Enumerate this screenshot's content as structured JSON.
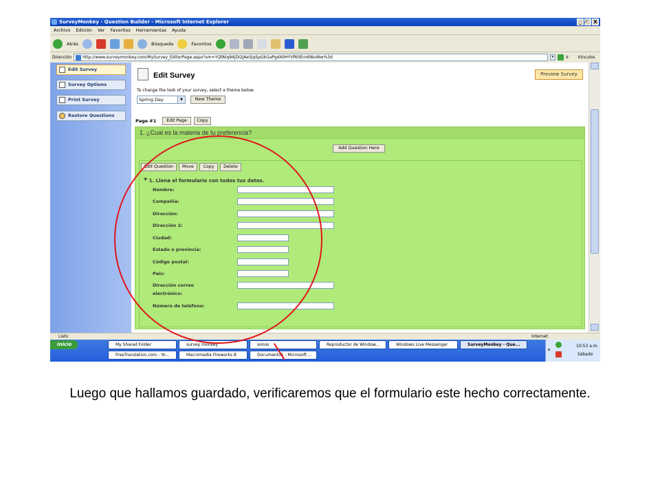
{
  "window": {
    "title": "SurveyMonkey - Question Builder - Microsoft Internet Explorer",
    "buttons": [
      "_",
      "̸",
      "X"
    ]
  },
  "menu": [
    "Archivo",
    "Edición",
    "Ver",
    "Favoritos",
    "Herramientas",
    "Ayuda"
  ],
  "toolbar": {
    "back": "Atrás",
    "search": "Búsqueda",
    "favorites": "Favoritos"
  },
  "address": {
    "label": "Dirección",
    "url": "http://www.surveymonkey.com/MySurvey_EditorPage.aspx?sm=YQfAtq94jDI2JAeSjqSpGkGaPgd40HYVf60Ern6WuWw%3d",
    "go": "Ir",
    "links": "Vínculos"
  },
  "sidebar": {
    "items": [
      {
        "label": "Edit Survey"
      },
      {
        "label": "Survey Options"
      },
      {
        "label": "Print Survey"
      },
      {
        "label": "Restore Questions"
      }
    ]
  },
  "main": {
    "title": "Edit Survey",
    "preview_button": "Preview Survey",
    "hint": "To change the look of your survey, select a theme below.",
    "theme": "Spring Day",
    "new_theme_button": "New Theme",
    "page_label": "Page #1",
    "edit_page_button": "Edit Page",
    "copy_page_button": "Copy",
    "question_title": "1. ¿Cual es la materia de tu preferencia?",
    "add_question_button": "Add Question Here",
    "q_edit_button": "Edit Question",
    "q_move_button": "Move",
    "q_copy_button": "Copy",
    "q_delete_button": "Delete",
    "required_mark": "*",
    "form_title": "1. Llena el formulario con todos tus datos.",
    "fields": [
      {
        "label": "Nombre:"
      },
      {
        "label": "Compañia:"
      },
      {
        "label": "Dirección:"
      },
      {
        "label": "Dirección 2:"
      },
      {
        "label": "Ciudad:"
      },
      {
        "label": "Estado o provincia:"
      },
      {
        "label": "Código postal:"
      },
      {
        "label": "País:"
      },
      {
        "label": "Dirección correo"
      },
      {
        "label": "electrónico:"
      },
      {
        "label": "Número de teléfono:"
      }
    ]
  },
  "status": {
    "left": "Listo",
    "zone": "Internet"
  },
  "taskbar": {
    "start": "Inicio",
    "tasks": [
      "My Shared Folder",
      "survey monkey",
      "sonos",
      "Reproductor de Window...",
      "Windows Live Messenger",
      "SurveyMonkey - Que...",
      "FreeTranslation.com - Yo...",
      "Macromedia Fireworks 8",
      "Documento1 - Microsoft ..."
    ],
    "clock": "10:53 a.m.",
    "day": "Sábado"
  },
  "caption": "Luego que hallamos guardado, verificaremos que el formulario este hecho correctamente.",
  "colors": {
    "accent": "#e0141a",
    "question_bg": "#b0ea7a",
    "taskbar": "#245edb"
  }
}
